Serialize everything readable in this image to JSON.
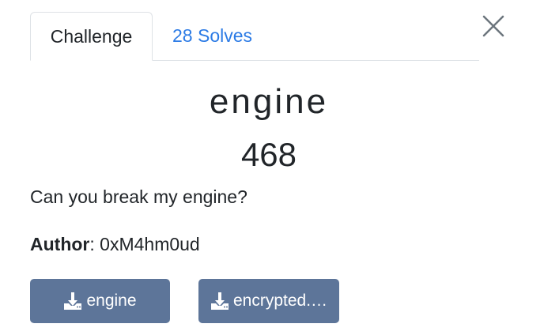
{
  "tabs": [
    {
      "label": "Challenge"
    },
    {
      "label": "28 Solves"
    }
  ],
  "challenge": {
    "name": "engine",
    "points": "468",
    "description": "Can you break my engine?",
    "author_label": "Author",
    "author_sep": ": ",
    "author": "0xM4hm0ud"
  },
  "files": [
    {
      "label": "engine",
      "icon": "download-icon"
    },
    {
      "label": "encrypted.…",
      "icon": "download-icon"
    }
  ],
  "colors": {
    "link": "#2c7be5",
    "button_bg": "#5d7599",
    "text": "#212529"
  }
}
